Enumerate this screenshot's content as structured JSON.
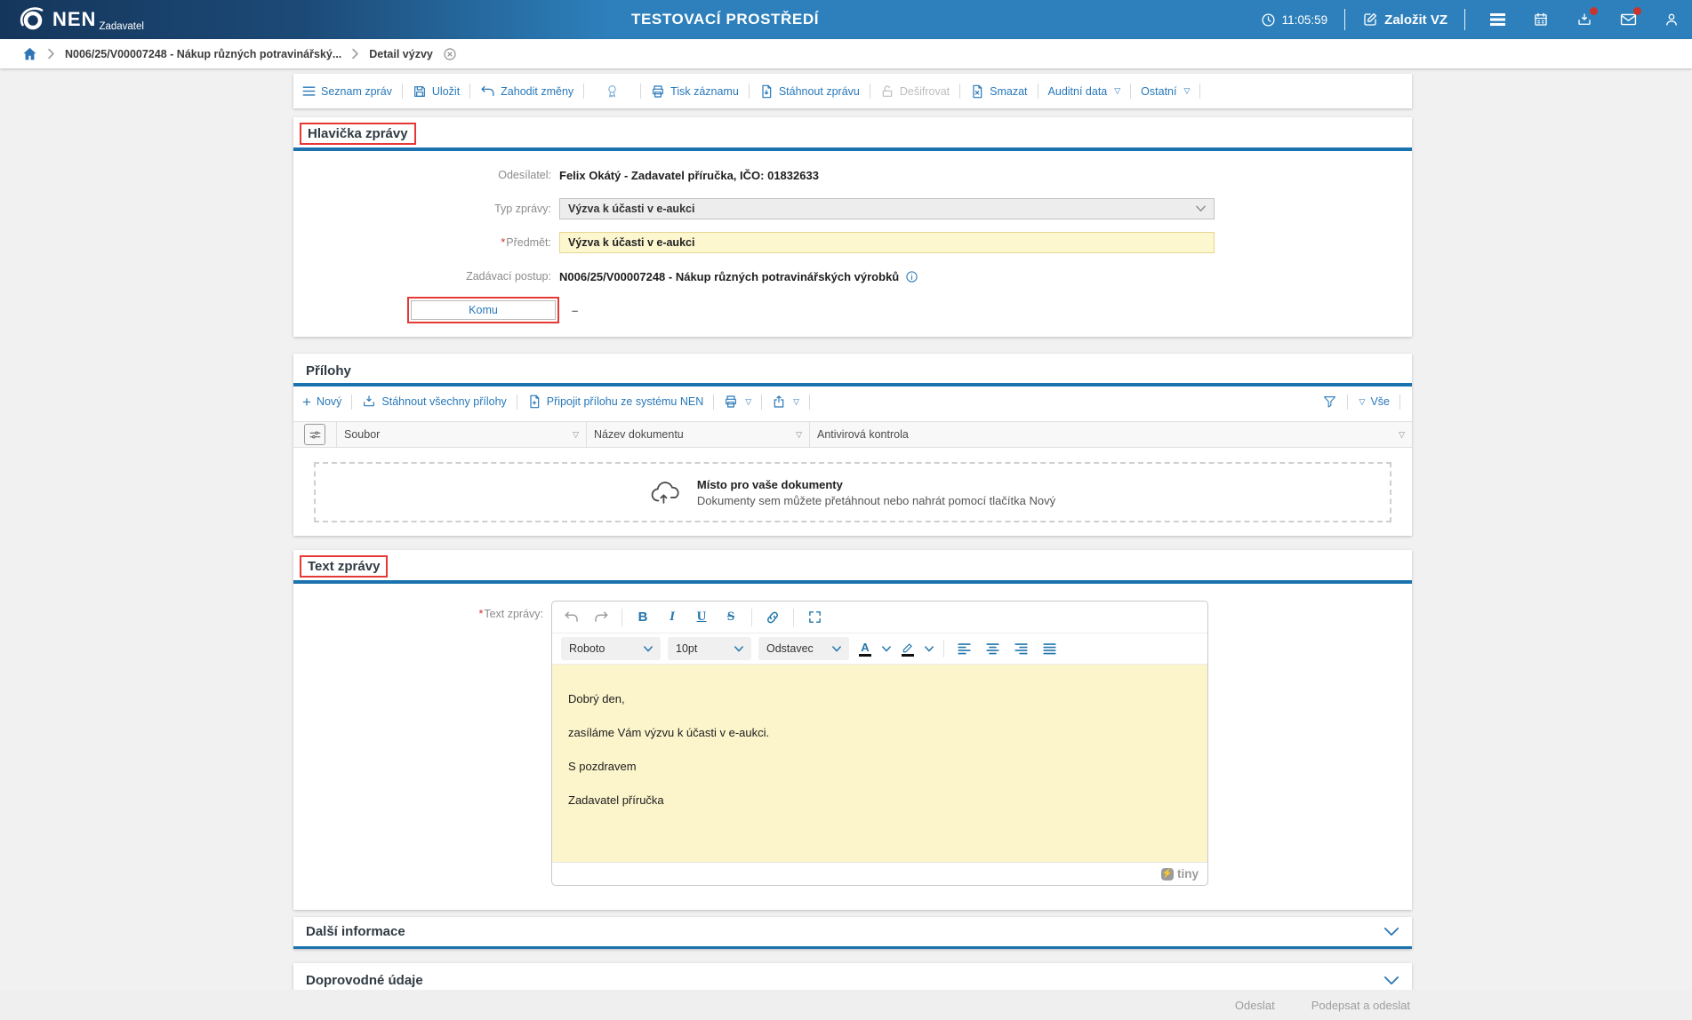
{
  "header": {
    "brand": "NEN",
    "brand_sub": "Zadavatel",
    "environment": "TESTOVACÍ PROSTŘEDÍ",
    "time": "11:05:59",
    "create_vz_label": "Založit VZ"
  },
  "breadcrumb": {
    "process": "N006/25/V00007248 - Nákup různých potravinářský...",
    "detail": "Detail výzvy"
  },
  "toolbar": {
    "seznam": "Seznam zpráv",
    "ulozit": "Uložit",
    "zahodit": "Zahodit změny",
    "tisk": "Tisk záznamu",
    "stahnout": "Stáhnout zprávu",
    "desifrovat": "Dešifrovat",
    "smazat": "Smazat",
    "auditni": "Auditní data",
    "ostatni": "Ostatní"
  },
  "hlavicka": {
    "title": "Hlavička zprávy",
    "required_mark": "*",
    "odesilatel_label": "Odesílatel:",
    "odesilatel_value": "Felix Okátý - Zadavatel příručka, IČO: 01832633",
    "typ_label": "Typ zprávy:",
    "typ_value": "Výzva k účasti v e-aukci",
    "predmet_label": "Předmět:",
    "predmet_value": "Výzva k účasti v e-aukci",
    "postup_label": "Zadávací postup:",
    "postup_value": "N006/25/V00007248 - Nákup různých potravinářských výrobků",
    "komu_label": "Komu",
    "komu_value": "–"
  },
  "prilohy": {
    "title": "Přílohy",
    "novy": "Nový",
    "stahnout_vse": "Stáhnout všechny přílohy",
    "pripojit": "Připojit přílohu ze systému NEN",
    "vse": "Vše",
    "columns": [
      "Soubor",
      "Název dokumentu",
      "Antivirová kontrola"
    ],
    "empty_title": "Místo pro vaše dokumenty",
    "empty_sub": "Dokumenty sem můžete přetáhnout nebo nahrát pomocí tlačítka Nový"
  },
  "text_zpravy": {
    "title": "Text zprávy",
    "required_mark": "*",
    "field_label": "Text zprávy:",
    "editor": {
      "font_name": "Roboto",
      "font_size": "10pt",
      "block_format": "Odstavec",
      "bold_glyph": "B",
      "italic_glyph": "I",
      "underline_glyph": "U",
      "strike_glyph": "S",
      "color_glyph": "A",
      "lines": [
        "Dobrý den,",
        "zasíláme Vám výzvu k účasti v e-aukci.",
        "S pozdravem",
        "Zadavatel příručka"
      ],
      "brand": "tiny"
    }
  },
  "sections": {
    "dalsi_informace": "Další informace",
    "doprovodne_udaje": "Doprovodné údaje"
  },
  "footer": {
    "odeslat": "Odeslat",
    "podepsat": "Podepsat a odeslat"
  },
  "colors": {
    "header_navy": "#15365c",
    "header_blue": "#2d80bc",
    "accent_blue": "#2878b9",
    "underline_blue": "#1b72ae",
    "annotation_red": "#e53935",
    "field_yellow": "#fdf7d0",
    "editor_yellow": "#fcf5cb",
    "badge_red": "#c9342c"
  }
}
